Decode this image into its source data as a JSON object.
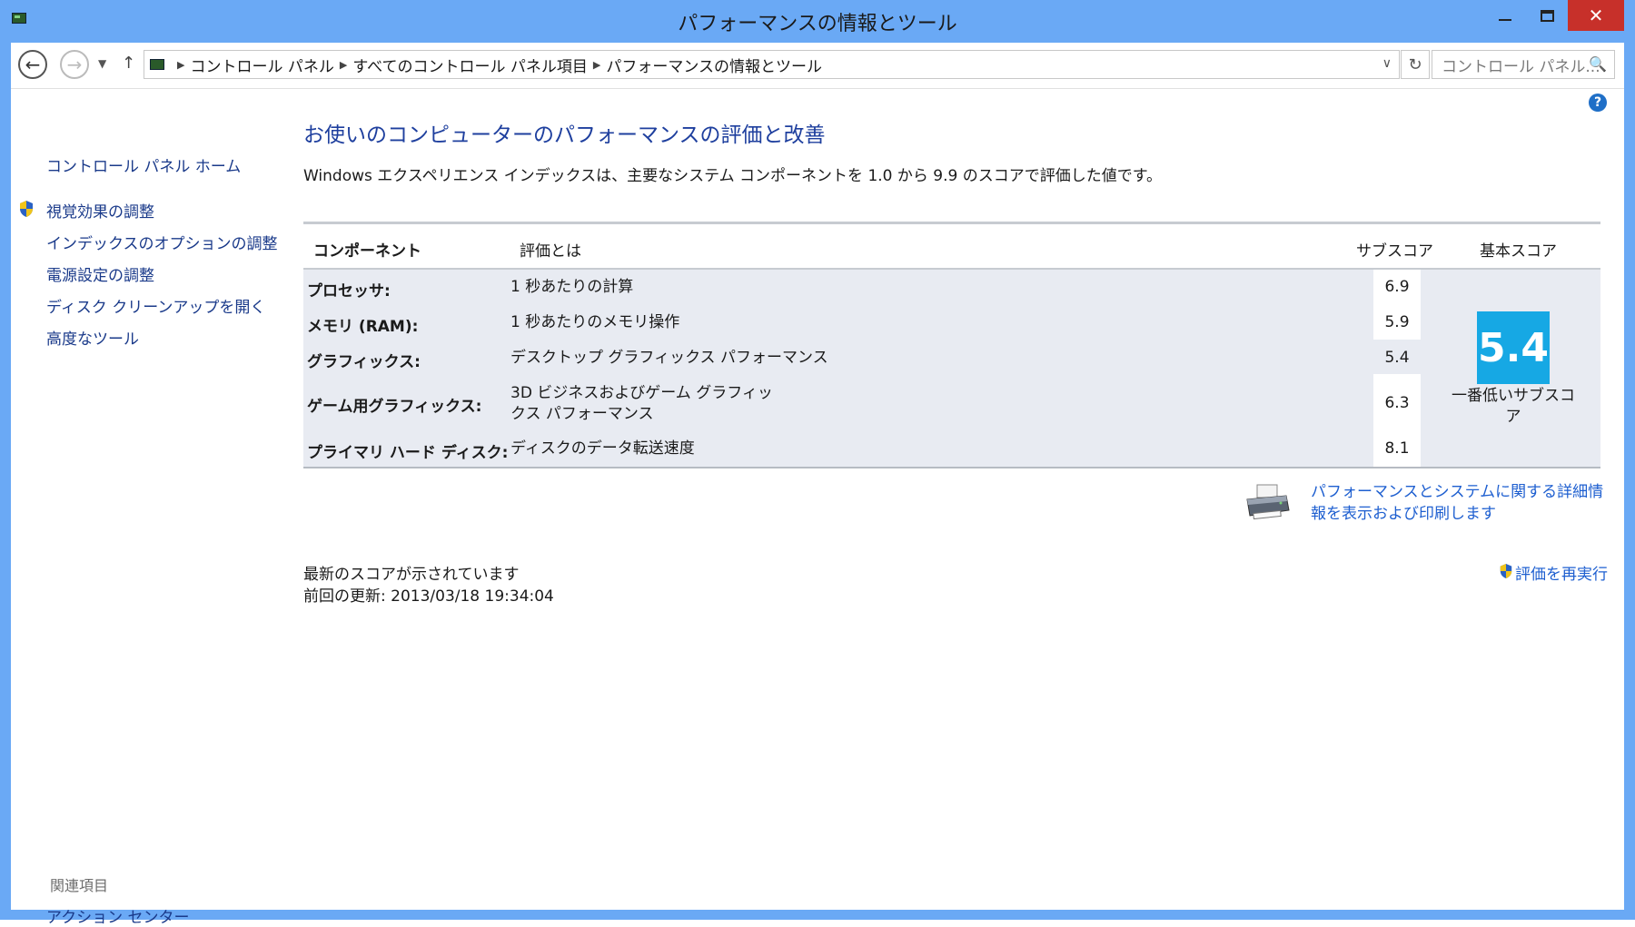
{
  "window": {
    "title": "パフォーマンスの情報とツール"
  },
  "nav": {
    "breadcrumbs": [
      "コントロール パネル",
      "すべてのコントロール パネル項目",
      "パフォーマンスの情報とツール"
    ],
    "search_placeholder": "コントロール パネル..."
  },
  "sidebar": {
    "home": "コントロール パネル ホーム",
    "items": [
      "視覚効果の調整",
      "インデックスのオプションの調整",
      "電源設定の調整",
      "ディスク クリーンアップを開く",
      "高度なツール"
    ],
    "related_header": "関連項目",
    "related_items": [
      "アクション センター"
    ]
  },
  "main": {
    "title": "お使いのコンピューターのパフォーマンスの評価と改善",
    "description": "Windows エクスペリエンス インデックスは、主要なシステム コンポーネントを 1.0 から 9.9 のスコアで評価した値です。",
    "table": {
      "headers": [
        "コンポーネント",
        "評価とは",
        "サブスコア",
        "基本スコア"
      ],
      "rows": [
        {
          "component": "プロセッサ:",
          "rating": "1 秒あたりの計算",
          "subscore": "6.9"
        },
        {
          "component": "メモリ (RAM):",
          "rating": "1 秒あたりのメモリ操作",
          "subscore": "5.9"
        },
        {
          "component": "グラフィックス:",
          "rating": "デスクトップ グラフィックス パフォーマンス",
          "subscore": "5.4"
        },
        {
          "component": "ゲーム用グラフィックス:",
          "rating": "3D ビジネスおよびゲーム グラフィックス パフォーマンス",
          "subscore": "6.3"
        },
        {
          "component": "プライマリ ハード ディスク:",
          "rating": "ディスクのデータ転送速度",
          "subscore": "8.1"
        }
      ],
      "base_score": "5.4",
      "base_caption": "一番低いサブスコア"
    },
    "print_link": "パフォーマンスとシステムに関する詳細情報を表示および印刷します",
    "status_line": "最新のスコアが示されています",
    "last_update": "前回の更新: 2013/03/18 19:34:04",
    "rerun_link": "評価を再実行"
  },
  "colors": {
    "frame": "#6aa9f5",
    "close": "#c7302a",
    "link": "#1e5fd0",
    "title_blue": "#1e3f9e",
    "score_tile": "#16a8e4",
    "table_bg": "#e8ebf2"
  }
}
